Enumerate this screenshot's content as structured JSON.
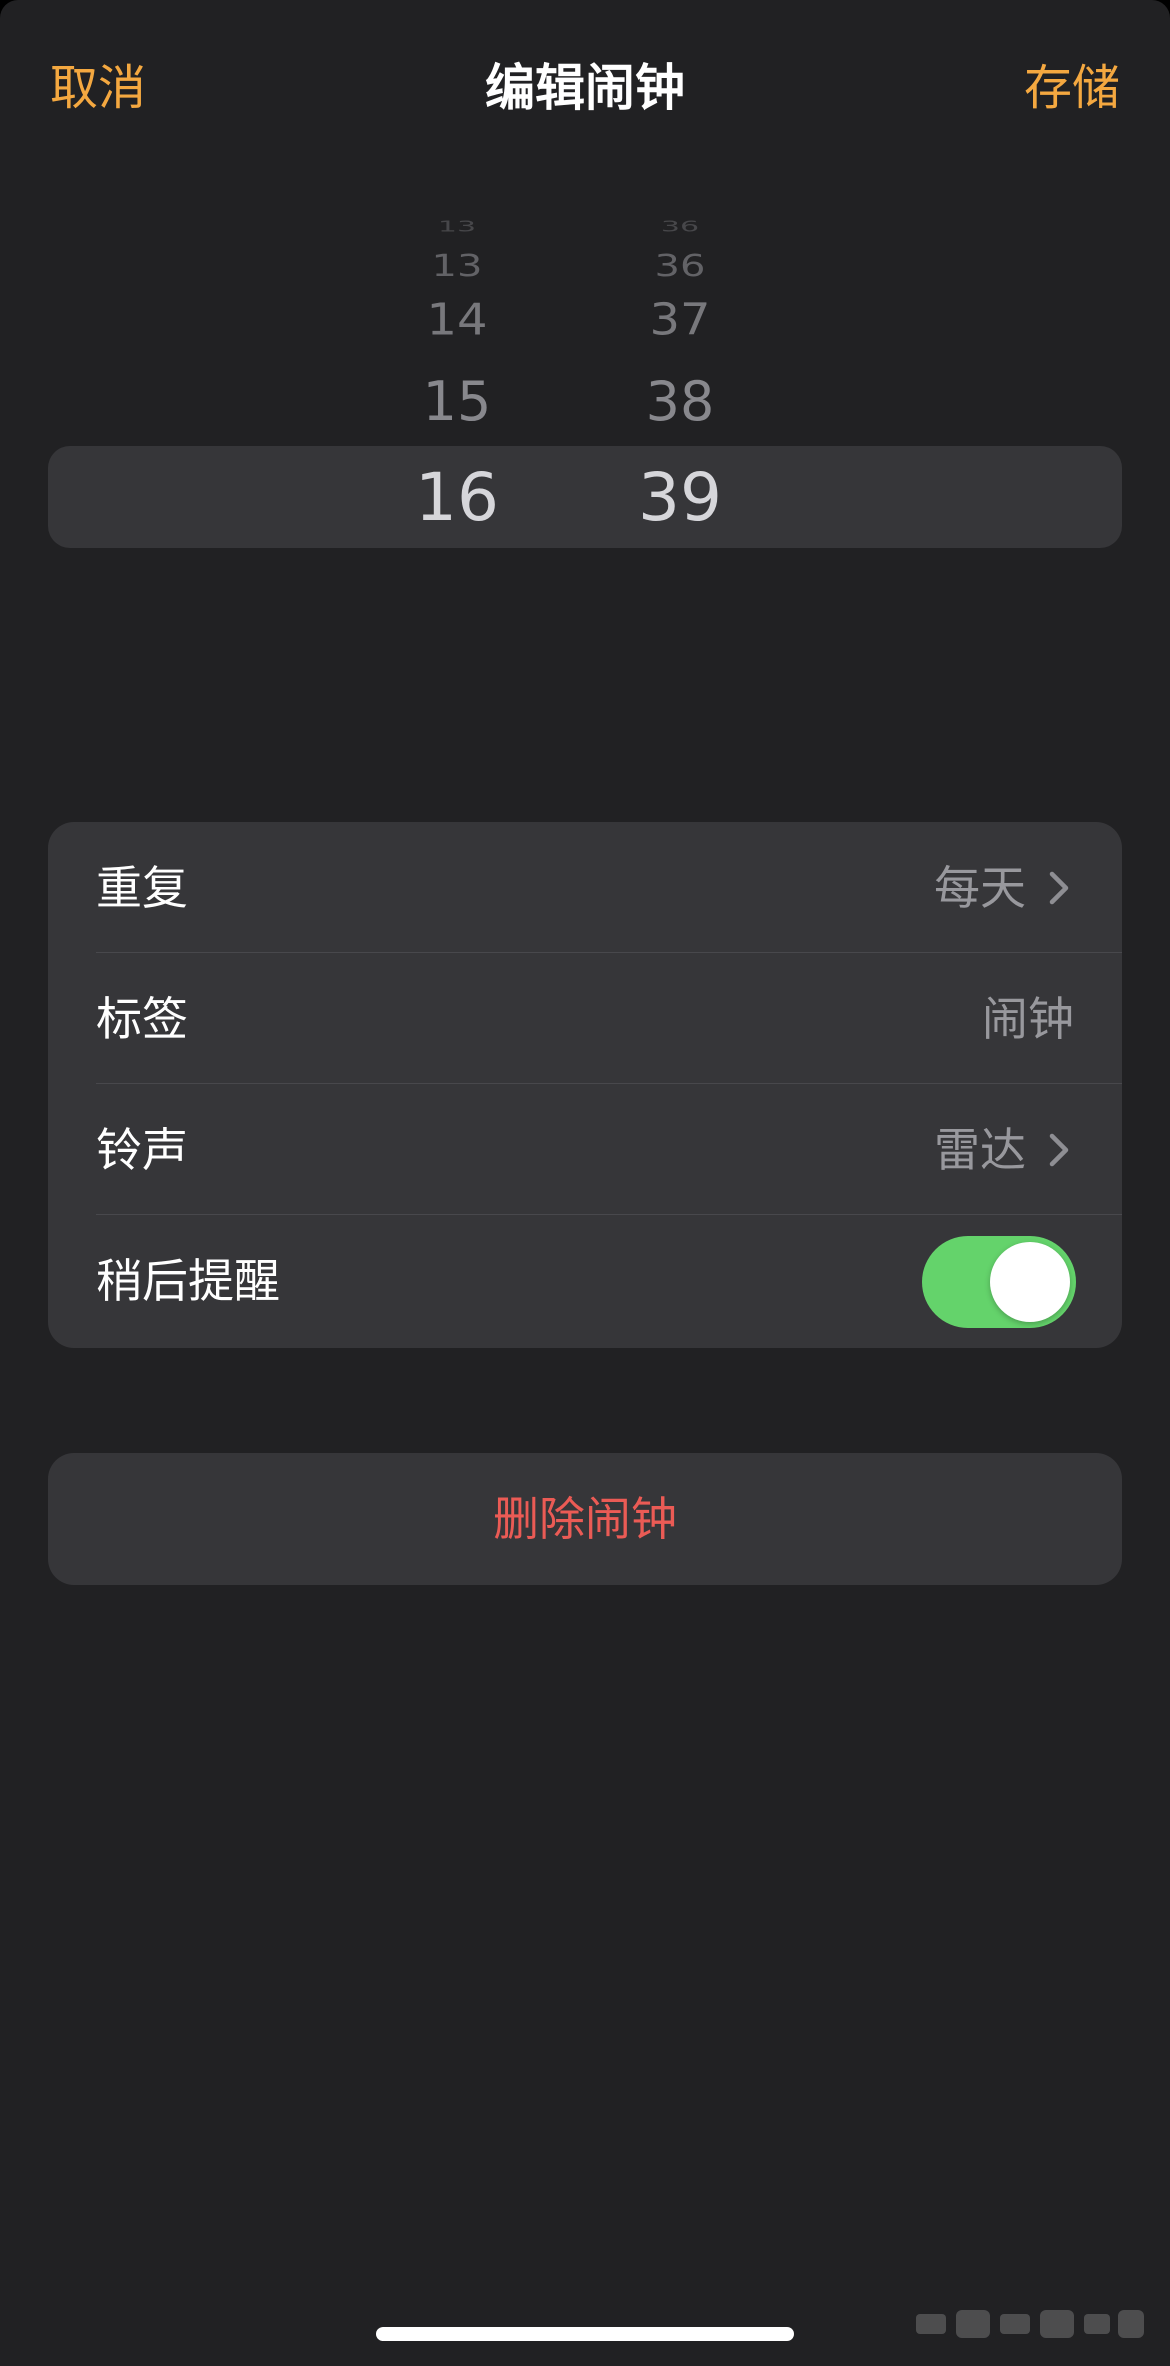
{
  "nav": {
    "cancel_label": "取消",
    "title": "编辑闹钟",
    "save_label": "存储"
  },
  "picker": {
    "hours": [
      "13",
      "13",
      "14",
      "15",
      "16"
    ],
    "minutes": [
      "36",
      "36",
      "37",
      "38",
      "39"
    ],
    "selected_hour": "16",
    "selected_minute": "39"
  },
  "settings": {
    "repeat": {
      "label": "重复",
      "value": "每天",
      "icon": "chevron-right-icon"
    },
    "label": {
      "label": "标签",
      "value": "闹钟"
    },
    "sound": {
      "label": "铃声",
      "value": "雷达",
      "icon": "chevron-right-icon"
    },
    "snooze": {
      "label": "稍后提醒",
      "enabled": true
    }
  },
  "delete": {
    "label": "删除闹钟"
  },
  "colors": {
    "accent": "#f4a840",
    "background": "#212123",
    "cell": "#363639",
    "toggle_on": "#64d36b",
    "destructive": "#eb5b55"
  }
}
